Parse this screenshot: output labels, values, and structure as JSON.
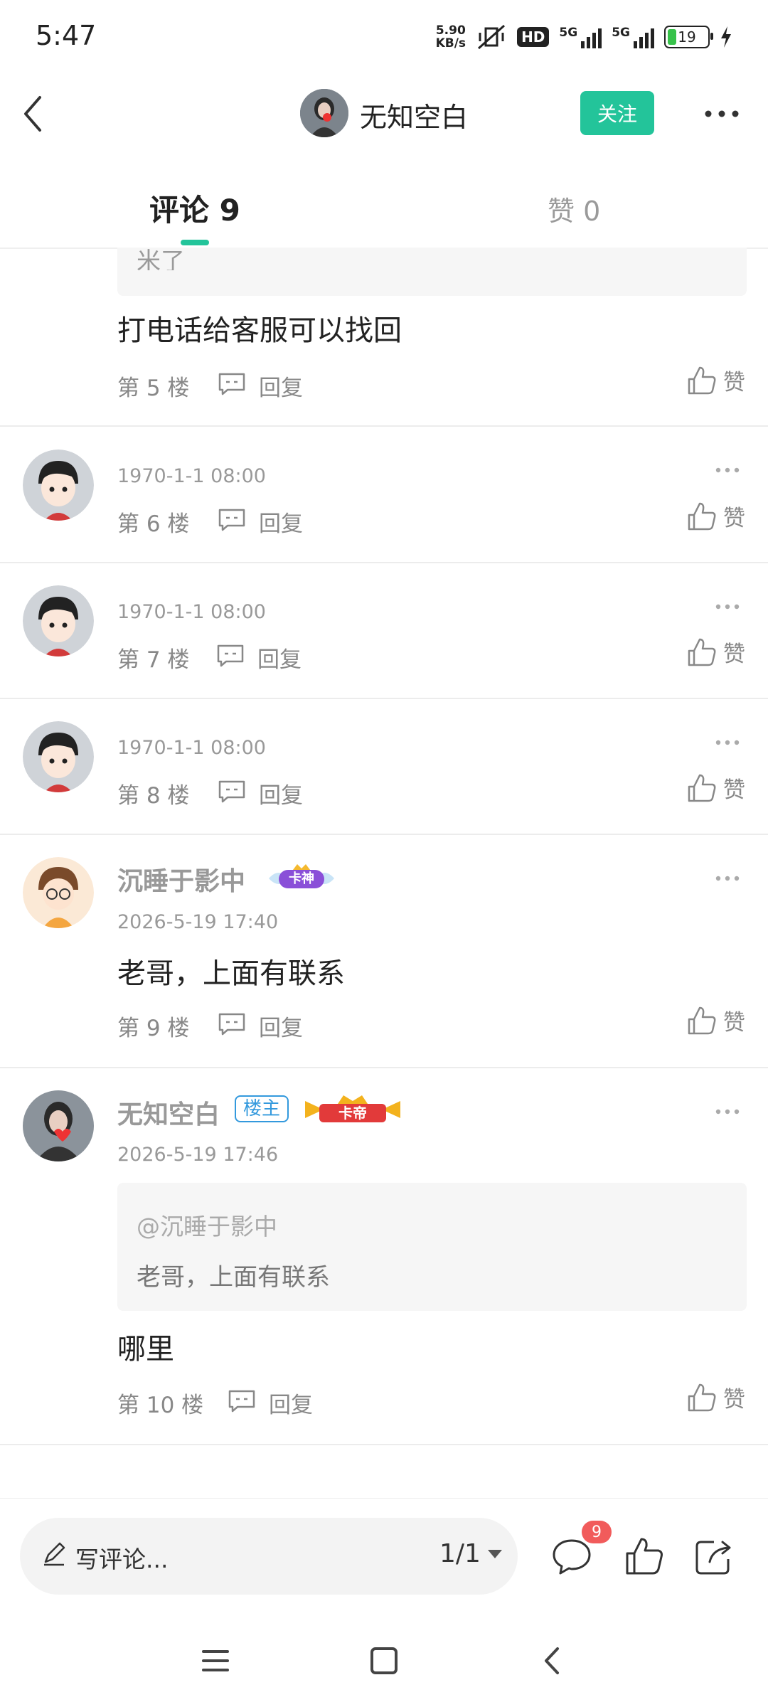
{
  "status_bar": {
    "time": "5:47",
    "speed_value": "5.90",
    "speed_unit": "KB/s",
    "hd": "HD",
    "net1": "5G",
    "net2": "5G",
    "battery": "19"
  },
  "header": {
    "name": "无知空白",
    "follow_label": "关注"
  },
  "tabs": {
    "comments": "评论 9",
    "likes": "赞 0"
  },
  "partial_top": {
    "quote_text": "米了",
    "comment_text": "打电话给客服可以找回",
    "floor": "第 5 楼",
    "reply": "回复",
    "like": "赞"
  },
  "comments": [
    {
      "date": "1970-1-1 08:00",
      "floor": "第 6 楼",
      "reply": "回复",
      "like": "赞"
    },
    {
      "date": "1970-1-1 08:00",
      "floor": "第 7 楼",
      "reply": "回复",
      "like": "赞"
    },
    {
      "date": "1970-1-1 08:00",
      "floor": "第 8 楼",
      "reply": "回复",
      "like": "赞"
    },
    {
      "user": "沉睡于影中",
      "badge": "卡神",
      "date": "2026-5-19 17:40",
      "text": "老哥，上面有联系",
      "floor": "第 9 楼",
      "reply": "回复",
      "like": "赞"
    },
    {
      "user": "无知空白",
      "owner_badge": "楼主",
      "badge": "卡帝",
      "date": "2026-5-19 17:46",
      "quote_at": "@沉睡于影中",
      "quote_text": "老哥，上面有联系",
      "text": "哪里",
      "floor": "第 10 楼",
      "reply": "回复",
      "like": "赞"
    }
  ],
  "bottom_bar": {
    "write_placeholder": "写评论...",
    "page": "1/1",
    "comment_count": "9"
  },
  "colors": {
    "accent": "#23c49a",
    "badge_red": "#f15b5b",
    "owner_blue": "#3399dd"
  }
}
